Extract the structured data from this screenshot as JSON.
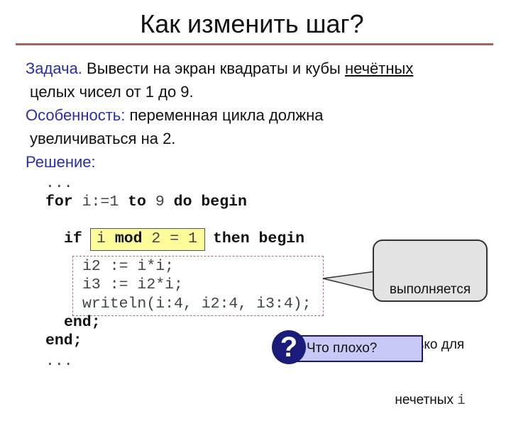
{
  "title": "Как изменить шаг?",
  "task": {
    "label": "Задача.",
    "text1": " Вывести на экран квадраты и кубы ",
    "underlined": "нечётных",
    "text2": "целых чисел от 1 до 9."
  },
  "feature": {
    "label": "Особенность:",
    "text1": " переменная цикла должна",
    "text2": "увеличиваться на 2."
  },
  "solution": {
    "label": "Решение:"
  },
  "code": {
    "dots1": "...",
    "for_kw": "for",
    "for_mid": " i:=1 ",
    "to_kw": "to",
    "nine": " 9 ",
    "do_kw": "do",
    "begin_kw": " begin",
    "if_kw": "if",
    "cond_i": "i ",
    "mod_kw": "mod",
    "cond_rest": " 2 = 1",
    "then_kw": "then begin",
    "line_i2": "i2 := i*i;",
    "line_i3": "i3 := i2*i;",
    "line_writeln": "writeln(i:4, i2:4, i3:4);",
    "end1": "end;",
    "end2": "end;",
    "dots2": "..."
  },
  "callout": {
    "line1": "выполняется",
    "line2": "только для",
    "line3": "нечетных ",
    "var": "i"
  },
  "question": {
    "icon": "question-mark-icon",
    "glyph": "?",
    "text": "Что плохо?"
  },
  "colors": {
    "label": "#2a2fa8",
    "rule": "#a8605a",
    "highlight": "#fdfb9a",
    "question_bg": "#c9c9f7",
    "question_icon": "#1b1b7a"
  }
}
